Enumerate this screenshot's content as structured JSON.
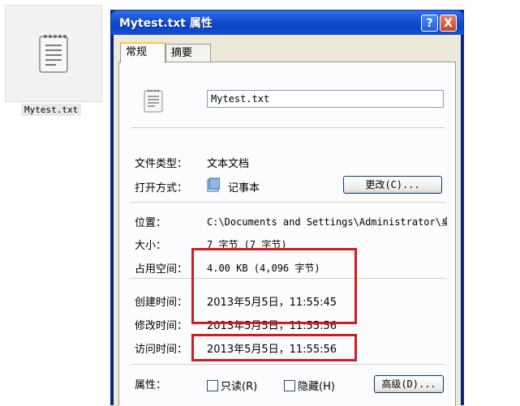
{
  "desktop": {
    "file_label": "Mytest.txt"
  },
  "window": {
    "title": "Mytest.txt 属性",
    "help_button": "?",
    "close_button": "X",
    "tabs": [
      "常规",
      "摘要"
    ]
  },
  "general": {
    "file_name": "Mytest.txt",
    "file_type_label": "文件类型：",
    "file_type_value": "文本文档",
    "open_with_label": "打开方式：",
    "open_with_value": "记事本",
    "change_button": "更改(C)...",
    "location_label": "位置：",
    "location_value": "C:\\Documents and Settings\\Administrator\\桌",
    "size_label": "大小：",
    "size_value": "7 字节 (7 字节)",
    "disk_size_label": "占用空间：",
    "disk_size_value": "4.00 KB (4,096 字节)",
    "created_label": "创建时间：",
    "created_value": "2013年5月5日，11:55:45",
    "modified_label": "修改时间：",
    "modified_value": "2013年5月5日，11:55:56",
    "accessed_label": "访问时间：",
    "accessed_value": "2013年5月5日，11:55:56",
    "attributes_label": "属性：",
    "readonly_label": "只读(R)",
    "hidden_label": "隐藏(H)",
    "readonly_checked": false,
    "hidden_checked": false,
    "advanced_button": "高级(D)..."
  },
  "colors": {
    "highlight_box": "#d01c22",
    "titlebar": "#0a44c6"
  }
}
